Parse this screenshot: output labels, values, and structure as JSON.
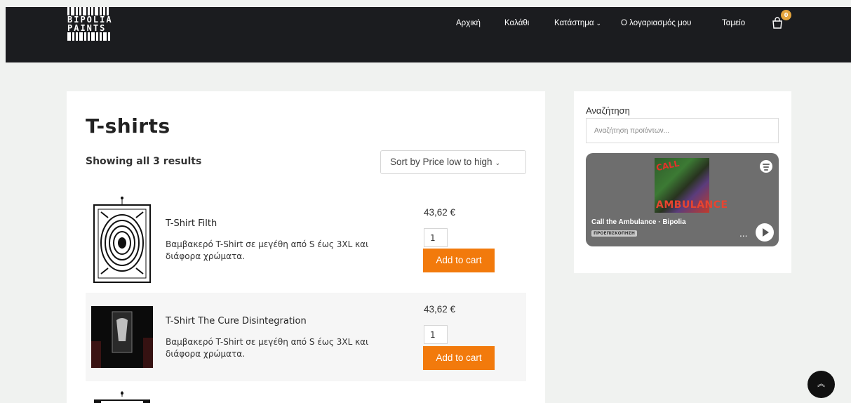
{
  "header": {
    "logo_text": [
      "BIPOLIA",
      "PAINTS"
    ],
    "nav": [
      {
        "label": "Αρχική"
      },
      {
        "label": "Καλάθι"
      },
      {
        "label": "Κατάστημα",
        "has_dropdown": true
      },
      {
        "label": "Ο λογαριασμός μου"
      },
      {
        "label": "Ταμείο"
      }
    ],
    "cart_count": "0",
    "cart_icon": "shopping-bag-icon"
  },
  "main": {
    "title": "T-shirts",
    "result_count": "Showing all 3 results",
    "sort_label": "Sort by Price low to high",
    "products": [
      {
        "name": "T-Shirt Filth",
        "description": "Βαμβακερό T-Shirt σε μεγέθη από S έως 3XL και διάφορα χρώματα.",
        "price": "43,62 €",
        "quantity": "1",
        "button": "Add to cart"
      },
      {
        "name": "T-Shirt The Cure Disintegration",
        "description": "Βαμβακερό T-Shirt σε μεγέθη από S έως 3XL και διάφορα χρώματα.",
        "price": "43,62 €",
        "quantity": "1",
        "button": "Add to cart"
      }
    ]
  },
  "sidebar": {
    "search_label": "Αναζήτηση",
    "search_placeholder": "Αναζήτηση προϊόντων...",
    "spotify": {
      "cover_title_top": "CALL",
      "cover_title_bottom": "AMBULANCE",
      "track": "Call the Ambulance · Bipolia",
      "tag": "ΠΡΟΕΠΙΣΚΟΠΗΣΗ",
      "more": "...",
      "icon": "spotify-icon"
    }
  },
  "colors": {
    "header_bg": "#1b1c1f",
    "accent": "#f27a0c",
    "badge": "#e4a43d",
    "page_bg": "#f0f2f0"
  }
}
